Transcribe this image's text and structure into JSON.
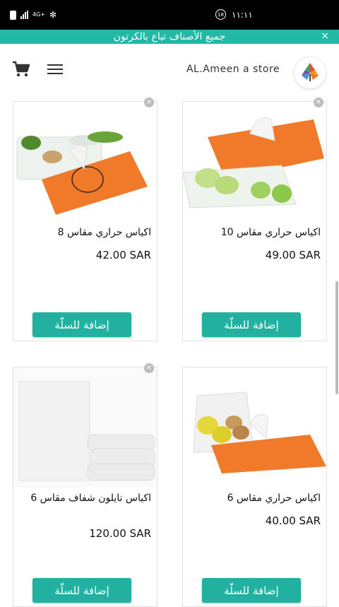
{
  "status_bar": {
    "network": "4G+",
    "time": "١١:١١"
  },
  "banner": {
    "text": "جميع الأصناف تباع بالكرتون",
    "close_symbol": "×"
  },
  "header": {
    "store_name": "AL.Ameen a store"
  },
  "products": [
    {
      "title": "اكياس حراري مقاس 8",
      "price": "42.00 SAR",
      "button": "إضافة للسلّة"
    },
    {
      "title": "اكياس حراري مقاس 10",
      "price": "49.00 SAR",
      "button": "إضافة للسلّة"
    },
    {
      "title": "اكياس نايلون شفاف مقاس 6",
      "price": "120.00 SAR",
      "button": "إضافة للسلّة"
    },
    {
      "title": "اكياس حراري مقاس 6",
      "price": "40.00 SAR",
      "button": "إضافة للسلّة"
    }
  ],
  "colors": {
    "accent": "#22b0a0",
    "banner": "#22b8a6",
    "bag_orange": "#f07a2a"
  }
}
